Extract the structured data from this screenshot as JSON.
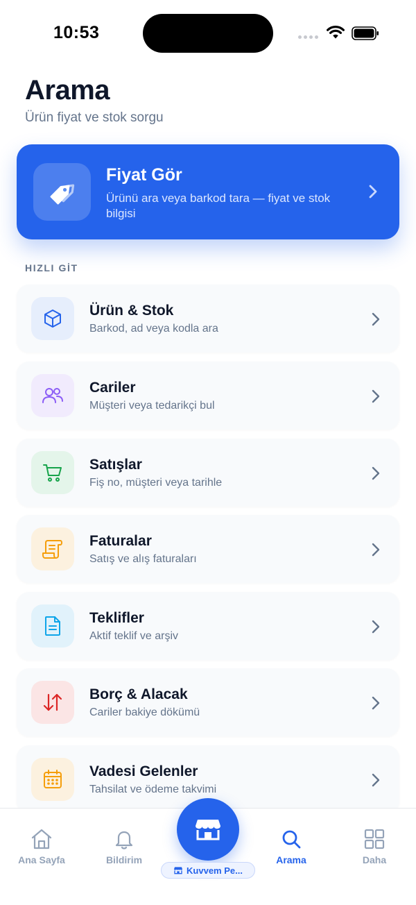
{
  "status_bar": {
    "time": "10:53"
  },
  "header": {
    "title": "Arama",
    "subtitle": "Ürün fiyat ve stok sorgu"
  },
  "hero": {
    "title": "Fiyat Gör",
    "description": "Ürünü ara veya barkod tara — fiyat ve stok bilgisi",
    "icon": "price-tag-icon",
    "color": "#2563eb"
  },
  "quick_go": {
    "label": "HIZLI GİT",
    "items": [
      {
        "title": "Ürün & Stok",
        "subtitle": "Barkod, ad veya kodla ara",
        "icon": "box-icon",
        "color": "#2563eb",
        "bg": "#e6eefc"
      },
      {
        "title": "Cariler",
        "subtitle": "Müşteri veya tedarikçi bul",
        "icon": "users-icon",
        "color": "#8b5cf6",
        "bg": "#f1ebfd"
      },
      {
        "title": "Satışlar",
        "subtitle": "Fiş no, müşteri veya tarihle",
        "icon": "cart-icon",
        "color": "#16a34a",
        "bg": "#e4f5ea"
      },
      {
        "title": "Faturalar",
        "subtitle": "Satış ve alış faturaları",
        "icon": "receipt-icon",
        "color": "#f59e0b",
        "bg": "#fcf1df"
      },
      {
        "title": "Teklifler",
        "subtitle": "Aktif teklif ve arşiv",
        "icon": "document-icon",
        "color": "#0ea5e9",
        "bg": "#e1f2fb"
      },
      {
        "title": "Borç & Alacak",
        "subtitle": "Cariler bakiye dökümü",
        "icon": "arrows-up-down-icon",
        "color": "#dc2626",
        "bg": "#fbe5e5"
      },
      {
        "title": "Vadesi Gelenler",
        "subtitle": "Tahsilat ve ödeme takvimi",
        "icon": "calendar-icon",
        "color": "#f59e0b",
        "bg": "#fcf1df"
      }
    ]
  },
  "tab_bar": {
    "tabs": [
      {
        "label": "Ana Sayfa",
        "icon": "home-icon",
        "active": false
      },
      {
        "label": "Bildirim",
        "icon": "bell-icon",
        "active": false
      },
      {
        "label": "Arama",
        "icon": "search-icon",
        "active": true
      },
      {
        "label": "Daha",
        "icon": "grid-icon",
        "active": false
      }
    ],
    "center": {
      "icon": "store-icon",
      "store_name": "Kuvvem Pe..."
    },
    "active_color": "#2563eb",
    "inactive_color": "#94a3b8"
  }
}
